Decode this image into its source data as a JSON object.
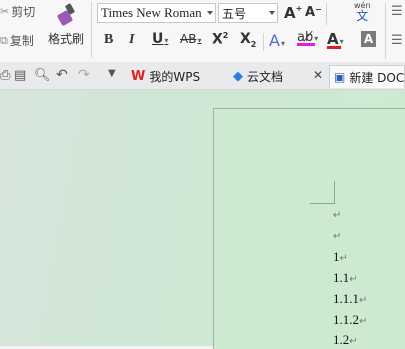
{
  "ribbon": {
    "cut_label": "剪切",
    "copy_label": "复制",
    "format_painter_label": "格式刷",
    "font_name": "Times New Roman",
    "font_size": "五号",
    "bold": "B",
    "italic": "I",
    "underline": "U",
    "strike": "AB",
    "superscript_base": "X",
    "superscript_mark": "2",
    "subscript_base": "X",
    "subscript_mark": "2",
    "grow_font": "A",
    "shrink_font": "A",
    "phonetic_top": "wén",
    "phonetic_bottom": "文",
    "text_effect": "A",
    "font_color": "A",
    "char_shading": "A",
    "colors": {
      "highlight": "#e81ae8",
      "font_color": "#e31b1b",
      "painter": "#9b59b6"
    }
  },
  "tabs": [
    {
      "label": "我的WPS",
      "icon": "wps-logo-icon"
    },
    {
      "label": "云文档",
      "icon": "cloud-doc-icon"
    },
    {
      "label": "新建 DOC",
      "icon": "document-icon"
    }
  ],
  "document": {
    "lines": [
      "",
      "",
      "1",
      "1.1",
      "1.1.1",
      "1.1.2",
      "1.2"
    ],
    "paragraph_mark": "↵"
  }
}
